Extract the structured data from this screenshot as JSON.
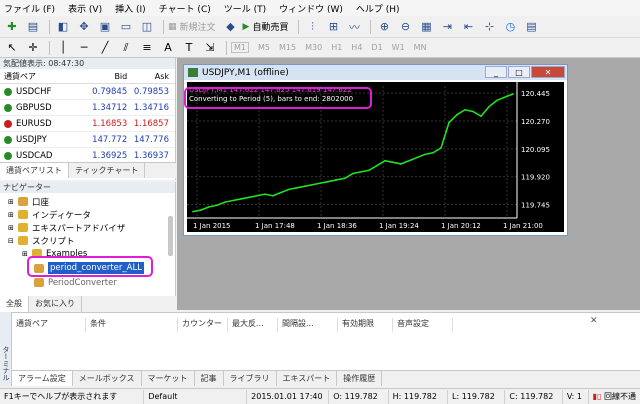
{
  "menu": [
    "ファイル (F)",
    "表示 (V)",
    "挿入 (I)",
    "チャート (C)",
    "ツール (T)",
    "ウィンドウ (W)",
    "ヘルプ (H)"
  ],
  "toolbar": {
    "new_order_label": "新規注文",
    "auto_trading_label": "自動売買",
    "timeframes": [
      "M1",
      "M5",
      "M15",
      "M30",
      "H1",
      "H4",
      "D1",
      "W1",
      "MN"
    ]
  },
  "market_watch": {
    "title": "気配値表示: 08:47:30",
    "headers": {
      "symbol": "通貨ペア",
      "bid": "Bid",
      "ask": "Ask"
    },
    "rows": [
      {
        "symbol": "USDCHF",
        "bid": "0.79845",
        "ask": "0.79853",
        "color": "blue"
      },
      {
        "symbol": "GBPUSD",
        "bid": "1.34712",
        "ask": "1.34716",
        "color": "blue"
      },
      {
        "symbol": "EURUSD",
        "bid": "1.16853",
        "ask": "1.16857",
        "color": "red"
      },
      {
        "symbol": "USDJPY",
        "bid": "147.772",
        "ask": "147.776",
        "color": "blue"
      },
      {
        "symbol": "USDCAD",
        "bid": "1.36925",
        "ask": "1.36937",
        "color": "blue"
      }
    ],
    "tabs": [
      "通貨ペアリスト",
      "ティックチャート"
    ]
  },
  "navigator": {
    "title": "ナビゲーター",
    "items": [
      "口座",
      "インディケータ",
      "エキスパートアドバイザ",
      "スクリプト",
      "Examples",
      "period_converter_ALL",
      "PeriodConverter"
    ],
    "tabs": [
      "全般",
      "お気に入り"
    ]
  },
  "chart_window": {
    "title": "USDJPY,M1 (offline)",
    "ohlc_line": "USDJPY,M1  147.622 147.625 147.619 147.622",
    "info_line": "Converting to Period (5), bars to end:  2802000",
    "buttons": [
      "_",
      "□",
      "✕"
    ]
  },
  "chart_data": {
    "type": "line",
    "x_ticks": [
      "1 Jan 2015",
      "1 Jan 17:48",
      "1 Jan 18:36",
      "1 Jan 19:24",
      "1 Jan 20:12",
      "1 Jan 21:00"
    ],
    "y_ticks": [
      "120.445",
      "120.270",
      "120.095",
      "119.920",
      "119.745"
    ],
    "ylim": [
      119.66,
      120.49
    ],
    "grid": true,
    "series": [
      {
        "values": [
          119.7,
          119.71,
          119.73,
          119.74,
          119.76,
          119.77,
          119.78,
          119.79,
          119.8,
          119.81,
          119.8,
          119.82,
          119.84,
          119.85,
          119.86,
          119.87,
          119.88,
          119.89,
          119.9,
          119.91,
          119.94,
          119.95,
          119.96,
          119.99,
          120.02,
          120.01,
          120.0,
          120.02,
          120.04,
          120.06,
          120.07,
          120.1,
          120.26,
          120.31,
          120.34,
          120.33,
          120.3,
          120.36,
          120.4,
          120.42,
          120.44
        ]
      }
    ]
  },
  "terminal": {
    "headers": [
      "通貨ペア",
      "条件",
      "カウンター",
      "最大反...",
      "間隔設...",
      "有効期限",
      "音声設定"
    ],
    "tabs": [
      "アラーム設定",
      "メールボックス",
      "マーケット",
      "記事",
      "ライブラリ",
      "エキスパート",
      "操作履歴"
    ],
    "side_label": "ターミナル"
  },
  "status_bar": {
    "help": "F1キーでヘルプが表示されます",
    "profile": "Default",
    "datetime": "2015.01.01 17:40",
    "open": "O: 119.782",
    "high": "H: 119.782",
    "low": "L: 119.782",
    "close": "C: 119.782",
    "volume": "V: 1",
    "connection": "回線不通"
  }
}
